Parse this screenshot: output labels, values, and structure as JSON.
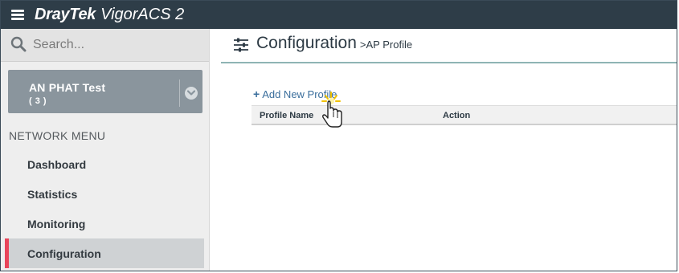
{
  "app": {
    "brand_primary": "DrayTek",
    "brand_secondary": "VigorACS 2",
    "icons": {
      "menu": "hamburger-menu-icon"
    }
  },
  "sidebar": {
    "search": {
      "placeholder": "Search..."
    },
    "group": {
      "name": "AN PHAT Test",
      "count": "( 3 )"
    },
    "menu_title": "NETWORK MENU",
    "items": [
      {
        "label": "Dashboard",
        "active": false
      },
      {
        "label": "Statistics",
        "active": false
      },
      {
        "label": "Monitoring",
        "active": false
      },
      {
        "label": "Configuration",
        "active": true
      }
    ]
  },
  "main": {
    "title": "Configuration",
    "subtitle": ">AP Profile",
    "add_link": {
      "plus": "+",
      "label": "Add New Profile"
    },
    "table": {
      "columns": [
        "Profile Name",
        "Action"
      ],
      "rows": []
    }
  },
  "colors": {
    "topbar": "#2e3d48",
    "sidebar": "#eeeeee",
    "group_card": "#8a959d",
    "active_indicator": "#e8455a",
    "link": "#3a6e9c",
    "title_underline": "#8fb4b4"
  }
}
